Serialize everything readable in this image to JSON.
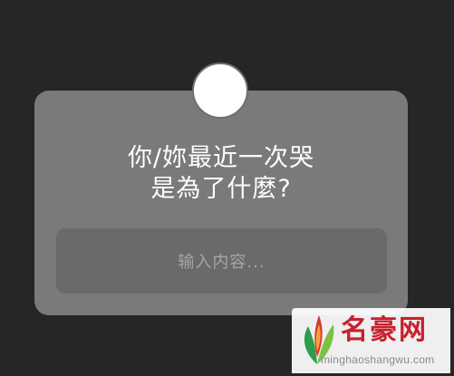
{
  "story_question": {
    "line1": "你/妳最近一次哭",
    "line2": "是為了什麼?",
    "answer_placeholder": "输入内容..."
  },
  "watermark": {
    "title": "名豪网",
    "domain": "minghaoshangwu.com"
  },
  "colors": {
    "background": "#262626",
    "card": "#7a7a7a",
    "input": "#6a6a6a",
    "text": "#ffffff",
    "placeholder": "#a6a6a6",
    "watermark_red": "#c8202e"
  }
}
